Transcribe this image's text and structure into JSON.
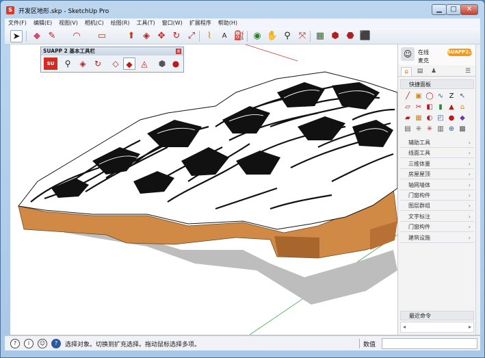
{
  "window": {
    "title": "开发区地形.skp - SketchUp Pro",
    "app_icon": "sketchup-logo-icon",
    "controls": {
      "minimize": "▁",
      "maximize": "□",
      "close": "✕"
    }
  },
  "menu": [
    "文件(F)",
    "编辑(E)",
    "视图(V)",
    "相机(C)",
    "绘图(R)",
    "工具(T)",
    "窗口(W)",
    "扩展程序",
    "帮助(H)"
  ],
  "toolbar": {
    "icons": [
      {
        "name": "select-arrow-icon",
        "glyph": "➤"
      },
      {
        "name": "eraser-icon",
        "glyph": "◆"
      },
      {
        "name": "pencil-line-icon",
        "glyph": "✎"
      },
      {
        "name": "arc-icon",
        "glyph": "◠"
      },
      {
        "name": "rectangle-icon",
        "glyph": "▭"
      },
      {
        "name": "push-pull-icon",
        "glyph": "⬆"
      },
      {
        "name": "offset-icon",
        "glyph": "◈"
      },
      {
        "name": "move-icon",
        "glyph": "✥"
      },
      {
        "name": "rotate-icon",
        "glyph": "↻"
      },
      {
        "name": "scale-icon",
        "glyph": "⤢"
      },
      {
        "name": "tape-measure-icon",
        "glyph": "⌇"
      },
      {
        "name": "text-icon",
        "glyph": "A"
      },
      {
        "name": "paint-bucket-icon",
        "glyph": "⛽"
      },
      {
        "name": "orbit-icon",
        "glyph": "◉"
      },
      {
        "name": "pan-icon",
        "glyph": "✋"
      },
      {
        "name": "zoom-icon",
        "glyph": "⚲"
      },
      {
        "name": "zoom-extents-icon",
        "glyph": "⤧"
      },
      {
        "name": "model-info-icon",
        "glyph": "▦"
      },
      {
        "name": "warehouse-icon",
        "glyph": "⬢"
      },
      {
        "name": "extension-warehouse-icon",
        "glyph": "⬣"
      },
      {
        "name": "send-to-layout-icon",
        "glyph": "⬛"
      }
    ]
  },
  "suapp_toolbar": {
    "title": "SUAPP 2 基本工具栏",
    "logo_text": "SU",
    "close": "x",
    "tools": [
      "search-tool-icon",
      "paint-tool-icon",
      "rotate-tool-icon",
      "offset-tool-icon",
      "eraser-tool-icon",
      "line-tool-icon",
      "group-tool-icon",
      "material-tool-icon"
    ]
  },
  "tray": {
    "user_status": "在线",
    "user_name": "麦克",
    "version_badge": "SUAPP2.5",
    "panel_title": "快捷面板",
    "sections": [
      "辅助工具",
      "线面工具",
      "三维体量",
      "房屋屋顶",
      "轴网墙体",
      "门窗构件",
      "图层群组",
      "文字标注",
      "门窗构件",
      "建筑设施"
    ],
    "recent_label": "最近命令",
    "scroll_left": "◂",
    "scroll_right": "▸"
  },
  "status": {
    "hint": "选择对象。切换到扩充选择。拖动鼠标选择多项。",
    "measure_label": "数值",
    "measure_value": ""
  },
  "colors": {
    "terrain_side": "#d08a45",
    "terrain_top": "#ffffff",
    "shadow": "#bcbcbc",
    "axis_red": "#d23c3c",
    "axis_green": "#3aa144",
    "badge_orange": "#f29a1f"
  }
}
